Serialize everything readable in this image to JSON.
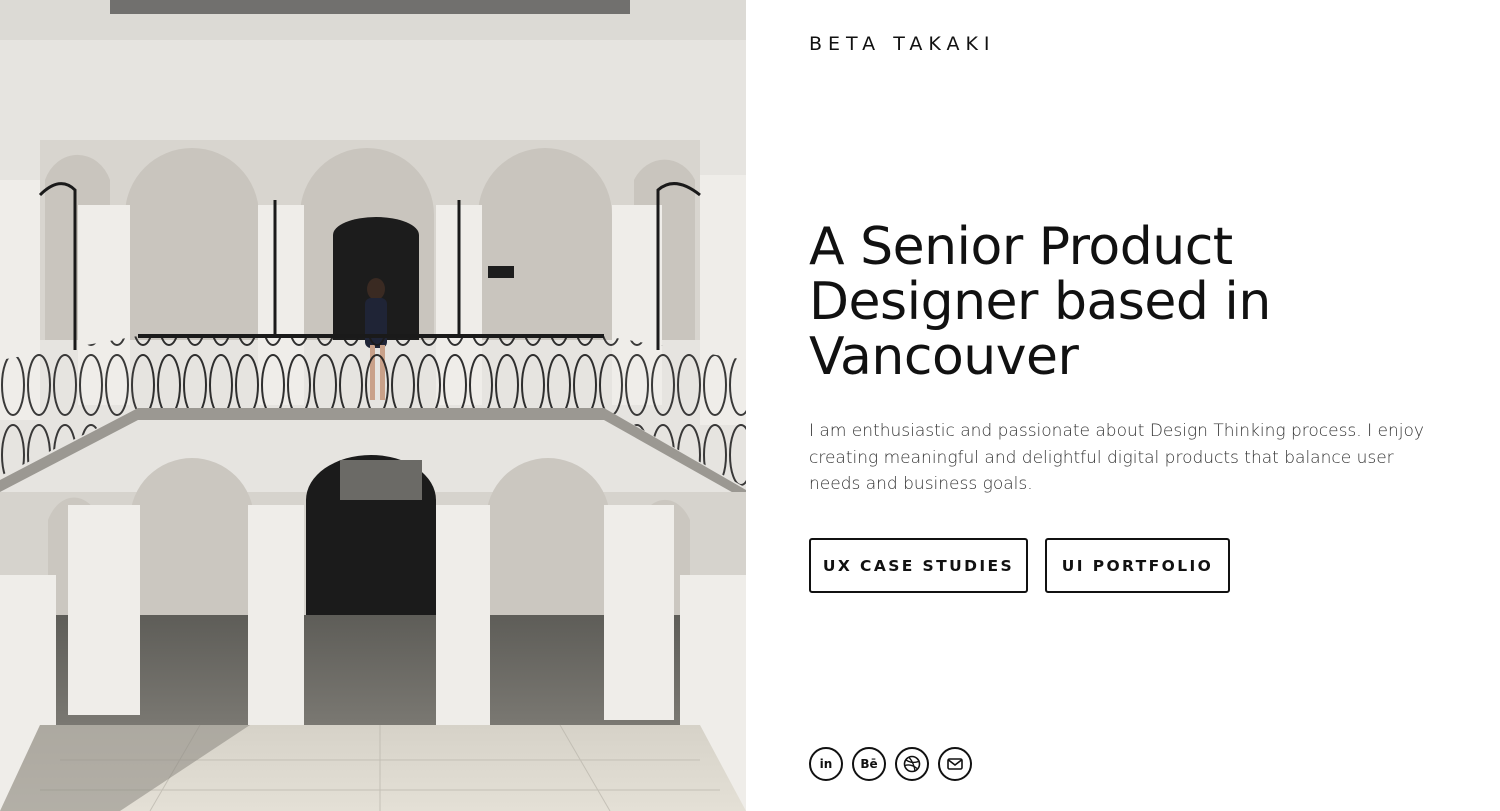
{
  "brand": {
    "name": "BETA TAKAKI"
  },
  "hero": {
    "headline_lines": [
      "A Senior Product",
      "Designer based in",
      "Vancouver"
    ],
    "intro": "I am enthusiastic and passionate about Design Thinking process. I enjoy creating meaningful and delightful digital products that balance user needs and business goals."
  },
  "buttons": {
    "ux_label": "UX CASE STUDIES",
    "ui_label": "UI PORTFOLIO"
  },
  "socials": [
    {
      "name": "linkedin-icon",
      "glyph": "in"
    },
    {
      "name": "behance-icon",
      "glyph": "Bē"
    },
    {
      "name": "dribbble-icon",
      "glyph": ""
    },
    {
      "name": "mail-icon",
      "glyph": ""
    }
  ]
}
